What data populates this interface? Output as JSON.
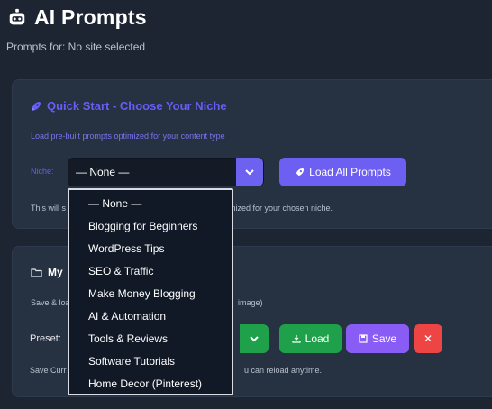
{
  "header": {
    "title": "AI Prompts",
    "icon": "robot-icon",
    "subtitle": "Prompts for: No site selected"
  },
  "quick_start": {
    "title": "Quick Start - Choose Your Niche",
    "icon": "rocket-icon",
    "description": "Load pre-built prompts optimized for your content type",
    "niche_label": "Niche:",
    "selected": "— None —",
    "load_all_label": "Load All Prompts",
    "note_start": "This will s",
    "note_end": "mized for your chosen niche."
  },
  "niche_options": [
    "— None —",
    "Blogging for Beginners",
    "WordPress Tips",
    "SEO & Traffic",
    "Make Money Blogging",
    "AI & Automation",
    "Tools & Reviews",
    "Software Tutorials",
    "Home Decor (Pinterest)"
  ],
  "my_presets": {
    "title_start": "My",
    "icon": "folder-icon",
    "desc_start": "Save & loa",
    "desc_end": "image)",
    "preset_label": "Preset:",
    "load_label": "Load",
    "save_label": "Save",
    "delete_glyph": "✕",
    "note_start": "Save Curr",
    "note_end": "u can reload anytime."
  },
  "colors": {
    "accent": "#6d5ff2",
    "green": "#1ea14a",
    "purple": "#8a5cf6",
    "red": "#ef4444",
    "bg": "#1d2532",
    "card": "#263142"
  }
}
